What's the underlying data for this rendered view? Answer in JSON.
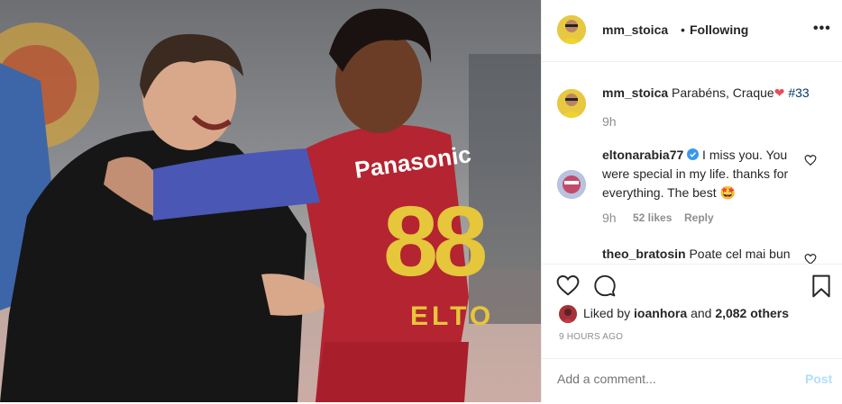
{
  "post": {
    "username": "mm_stoica",
    "separator": "•",
    "follow_status": "Following",
    "more_icon": "more-icon"
  },
  "photo": {
    "jersey_sponsor": "Panasonic",
    "jersey_number": "88",
    "jersey_name": "ELTO"
  },
  "comments": [
    {
      "username": "mm_stoica",
      "text": "Parabéns, Craque",
      "emoji": "❤",
      "hashtag": "#33",
      "time": "9h"
    },
    {
      "username": "eltonarabia77",
      "verified": true,
      "text": "I miss you. You were special in my life. thanks for everything. The best 🤩",
      "time": "9h",
      "likes": "52 likes",
      "reply_label": "Reply"
    },
    {
      "username": "theo_bratosin",
      "text": "Poate cel mai bun"
    }
  ],
  "actions": {
    "liked_by_prefix": "Liked by",
    "liked_by_user": "ioanhora",
    "liked_by_and": "and",
    "others": "2,082 others",
    "time_ago": "9 HOURS AGO"
  },
  "composer": {
    "placeholder": "Add a comment...",
    "post_label": "Post"
  },
  "colors": {
    "link_blue": "#003569",
    "hashtag_blue": "#00376b",
    "post_disabled": "#b2dffc",
    "heart_red": "#ed4956",
    "verified_blue": "#3897f0"
  }
}
